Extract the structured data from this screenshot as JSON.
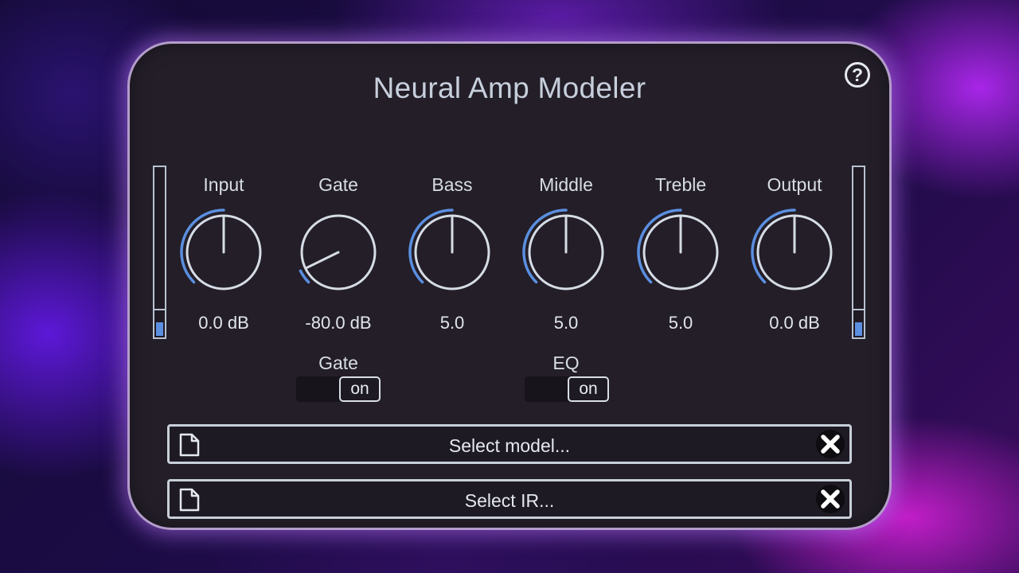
{
  "app": {
    "title": "Neural Amp Modeler",
    "help_symbol": "?"
  },
  "colors": {
    "accent": "#5b8fe0",
    "panel": "#231e28",
    "glow": "#be78ff"
  },
  "knobs": [
    {
      "label": "Input",
      "value": "0.0 dB",
      "level": 0.5
    },
    {
      "label": "Gate",
      "value": "-80.0 dB",
      "level": 0.07
    },
    {
      "label": "Bass",
      "value": "5.0",
      "level": 0.5
    },
    {
      "label": "Middle",
      "value": "5.0",
      "level": 0.5
    },
    {
      "label": "Treble",
      "value": "5.0",
      "level": 0.5
    },
    {
      "label": "Output",
      "value": "0.0 dB",
      "level": 0.5
    }
  ],
  "switches": [
    {
      "label": "Gate",
      "state": "on"
    },
    {
      "label": "EQ",
      "state": "on"
    }
  ],
  "file_selectors": {
    "model": {
      "label": "Select model...",
      "file_icon": "file-icon",
      "clear_icon": "close-icon"
    },
    "ir": {
      "label": "Select IR...",
      "file_icon": "file-icon",
      "clear_icon": "close-icon"
    }
  },
  "meters": {
    "input_level": 0.08,
    "output_level": 0.08
  }
}
